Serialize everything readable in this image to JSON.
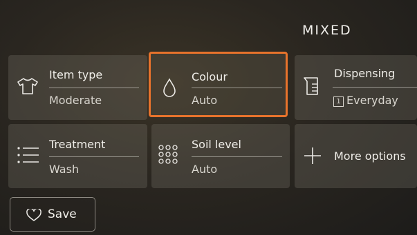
{
  "header": {
    "program": "MIXED"
  },
  "tiles": [
    {
      "name": "Item type",
      "value": "Moderate",
      "icon": "tshirt-icon",
      "selected": false
    },
    {
      "name": "Colour",
      "value": "Auto",
      "icon": "droplet-icon",
      "selected": true
    },
    {
      "name": "Dispensing",
      "value": "Everyday",
      "badge": "1",
      "icon": "detergent-cup-icon",
      "selected": false
    },
    {
      "name": "Treatment",
      "value": "Wash",
      "icon": "list-icon",
      "selected": false
    },
    {
      "name": "Soil level",
      "value": "Auto",
      "icon": "dots-grid-icon",
      "selected": false
    },
    {
      "name": "More options",
      "icon": "plus-icon",
      "selected": false
    }
  ],
  "footer": {
    "save_label": "Save",
    "save_icon": "heart-icon"
  },
  "colors": {
    "accent": "#e8732c",
    "text": "#f0eee9"
  }
}
